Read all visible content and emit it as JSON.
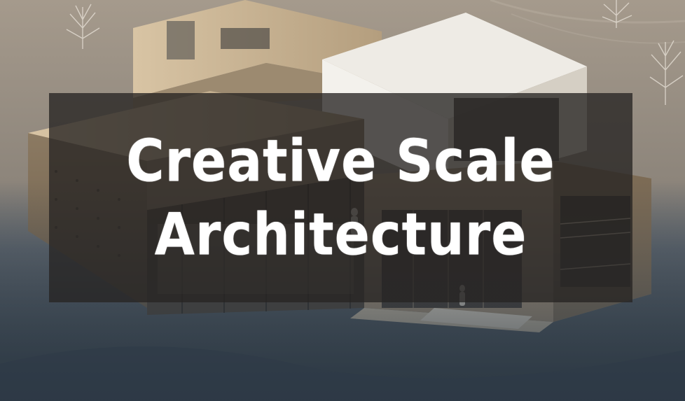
{
  "banner": {
    "line1": "Creative Scale",
    "line2": "Architecture"
  },
  "colors": {
    "banner_bg": "#262422",
    "title_text": "#ffffff",
    "wood": "#c9b393",
    "ground": "#3b4652"
  }
}
